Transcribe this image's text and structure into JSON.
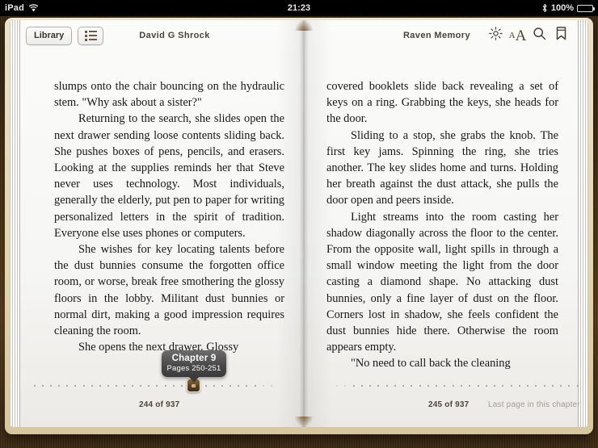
{
  "status_bar": {
    "device": "iPad",
    "wifi_icon": "wifi-icon",
    "time": "21:23",
    "bluetooth_icon": "bluetooth-icon",
    "battery_percent": "100%",
    "battery_icon": "battery-full-icon"
  },
  "toolbar": {
    "library_label": "Library",
    "toc_icon": "list-icon",
    "author": "David G Shrock",
    "title": "Raven Memory",
    "brightness_icon": "brightness-icon",
    "font_size_small_a": "A",
    "font_size_big_a": "A",
    "search_icon": "search-icon",
    "bookmark_icon": "bookmark-icon"
  },
  "left_page": {
    "paragraphs": [
      "slumps onto the chair bouncing on the hydraulic stem. \"Why ask about a sister?\"",
      "Returning to the search, she slides open the next drawer sending loose contents sliding back. She pushes boxes of pens, pencils, and erasers. Looking at the supplies reminds her that Steve never uses technology. Most individuals, generally the elderly, put pen to paper for writing personalized letters in the spirit of tradition. Everyone else uses phones or computers.",
      "She wishes for key locating talents before the dust bunnies consume the forgotten office room, or worse, break free smothering the glossy floors in the lobby. Militant dust bunnies or normal dirt, making a good impression requires cleaning the room.",
      "She opens the next drawer. Glossy"
    ],
    "page_counter": "244 of 937"
  },
  "right_page": {
    "paragraphs": [
      "covered booklets slide back revealing a set of keys on a ring. Grabbing the keys, she heads for the door.",
      "Sliding to a stop, she grabs the knob. The first key jams. Spinning the ring, she tries another. The key slides home and turns. Holding her breath against the dust attack, she pulls the door open and peers inside.",
      "Light streams into the room casting her shadow diagonally across the floor to the center. From the opposite wall, light spills in through a small window meeting the light from the door casting a diamond shape. No attacking dust bunnies, only a fine layer of dust on the floor. Corners lost in shadow, she feels confident the dust bunnies hide there. Otherwise the room appears empty.",
      "\"No need to call back the cleaning"
    ],
    "page_counter": "245 of 937",
    "chapter_hint": "Last page in this chapter"
  },
  "tooltip": {
    "chapter": "Chapter 9",
    "pages": "Pages 250-251"
  },
  "colors": {
    "book_cover": "#e4d7b4",
    "page": "#f8f8f6",
    "text": "#181818",
    "toolbar_text": "#4a4338",
    "slider_thumb": "#5d4322",
    "tooltip_bg": "#4a4a4a",
    "hint_text": "#a49c90"
  }
}
